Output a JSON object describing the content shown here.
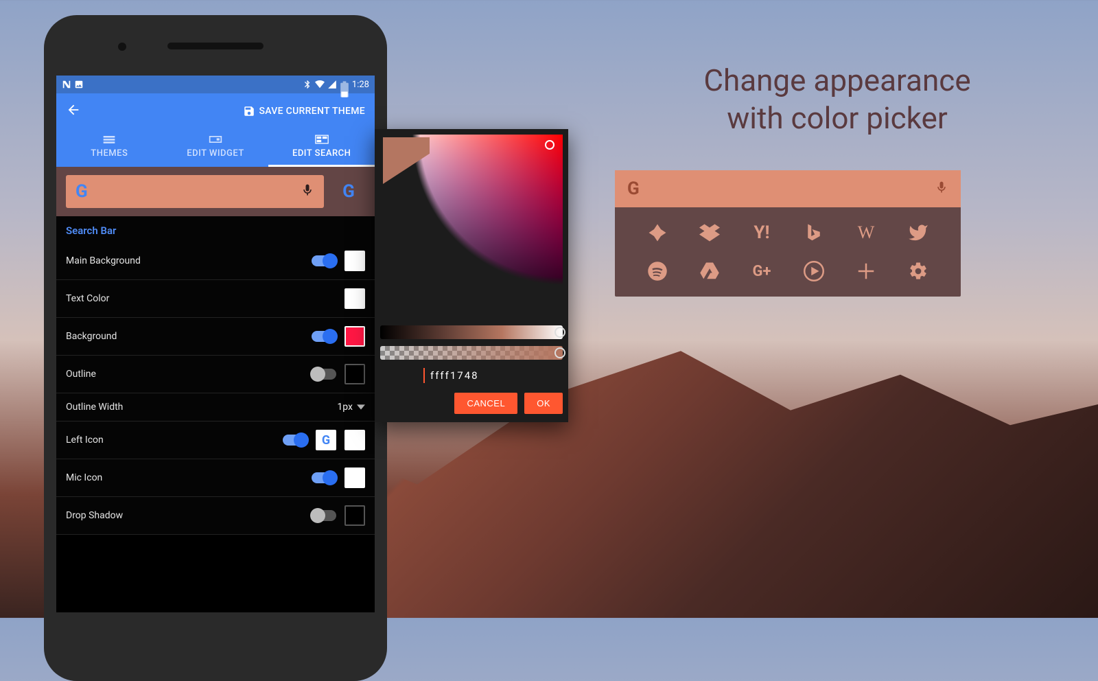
{
  "statusbar": {
    "time": "1:28"
  },
  "appbar": {
    "save_label": "SAVE CURRENT THEME",
    "tabs": [
      {
        "label": "THEMES"
      },
      {
        "label": "EDIT WIDGET"
      },
      {
        "label": "EDIT SEARCH"
      }
    ]
  },
  "section_title": "Search Bar",
  "rows": {
    "main_bg": {
      "label": "Main Background",
      "toggle": true,
      "swatch": "#ffffff"
    },
    "text_color": {
      "label": "Text Color",
      "swatch": "#ffffff"
    },
    "background": {
      "label": "Background",
      "toggle": true,
      "swatch": "#ff1744"
    },
    "outline": {
      "label": "Outline",
      "toggle": false,
      "swatch": "#000000"
    },
    "outline_width": {
      "label": "Outline Width",
      "value": "1px"
    },
    "left_icon": {
      "label": "Left Icon",
      "toggle": true,
      "swatch": "#ffffff"
    },
    "mic_icon": {
      "label": "Mic Icon",
      "toggle": true,
      "swatch": "#ffffff"
    },
    "drop_shadow": {
      "label": "Drop Shadow",
      "toggle": false,
      "swatch": "#000000"
    }
  },
  "picker": {
    "hex": "ffff1748",
    "cancel": "CANCEL",
    "ok": "OK",
    "selected_color": "#b47661"
  },
  "headline": {
    "line1": "Change appearance",
    "line2": "with color picker"
  },
  "widget": {
    "icons_row1": [
      "photos",
      "dropbox",
      "yahoo",
      "bing",
      "wikipedia",
      "twitter"
    ],
    "icons_row2": [
      "spotify",
      "drive",
      "google-plus",
      "play",
      "add",
      "settings"
    ]
  },
  "colors": {
    "accent": "#4285f4",
    "picker_accent": "#ff5730",
    "widget_bg": "#634747",
    "widget_bar": "#df8f74",
    "widget_icon": "#dd9b85"
  }
}
